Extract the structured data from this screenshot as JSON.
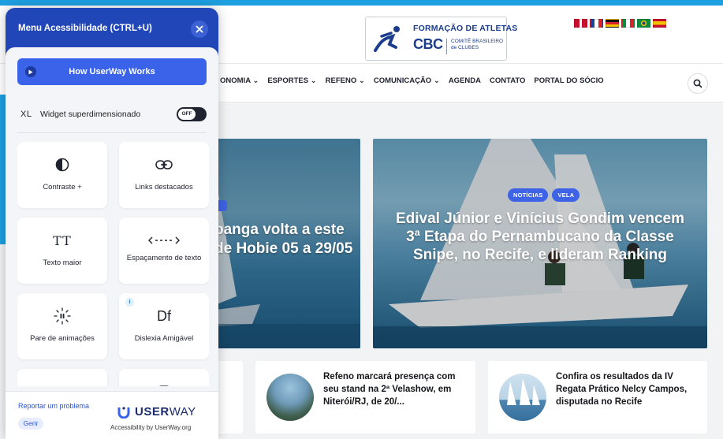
{
  "site": {
    "logo": {
      "line1": "FORMAÇÃO DE ATLETAS",
      "cbc": "CBC",
      "cb_line1": "COMITÊ BRASILEIRO",
      "cb_line2": "de CLUBES"
    },
    "nav": {
      "items": [
        "ONOMIA ⌄",
        "ESPORTES ⌄",
        "REFENO ⌄",
        "COMUNICAÇÃO ⌄",
        "AGENDA",
        "CONTATO",
        "PORTAL DO SÓCIO"
      ]
    },
    "featured": [
      {
        "title": "banga volta a este de Hobie 05 a 29/05"
      },
      {
        "badges": [
          "NOTÍCIAS",
          "VELA"
        ],
        "title": "Edival Júnior e Vinícius Gondim vencem 3ª Etapa do Pernambucano da Classe Snipe, no Recife, e lideram Ranking"
      }
    ],
    "news": [
      {
        "title": "Refeno marcará presença com seu stand na 2ª Velashow, em Niterói/RJ, de 20/..."
      },
      {
        "title": "Confira os resultados da IV Regata Prático Nelcy Campos, disputada no Recife"
      }
    ]
  },
  "panel": {
    "title": "Menu Acessibilidade (CTRL+U)",
    "how_button": "How UserWay Works",
    "xl_tag": "XL",
    "xl_label": "Widget superdimensionado",
    "toggle_state": "OFF",
    "tiles": [
      {
        "label": "Contraste +",
        "icon": "contrast-icon"
      },
      {
        "label": "Links destacados",
        "icon": "link-icon"
      },
      {
        "label": "Texto maior",
        "icon": "text-size-icon"
      },
      {
        "label": "Espaçamento de texto",
        "icon": "text-spacing-icon"
      },
      {
        "label": "Pare de animações",
        "icon": "pause-animations-icon"
      },
      {
        "label": "Dislexia Amigável",
        "icon": "dyslexia-icon",
        "glyph": "Df"
      },
      {
        "label": "",
        "icon": "cursor-icon"
      },
      {
        "label": "",
        "icon": "tooltip-icon"
      }
    ],
    "info_glyph": "i",
    "text_size_glyph": "TT",
    "footer": {
      "report": "Reportar um problema",
      "manage": "Gerir",
      "brand_bold": "USER",
      "brand_light": "WAY",
      "by": "Accessibility by UserWay.org"
    }
  },
  "colors": {
    "accent": "#1e9fe0",
    "panel_header": "#2146b8",
    "button": "#3a63ea",
    "badge": "#3f63e6"
  }
}
